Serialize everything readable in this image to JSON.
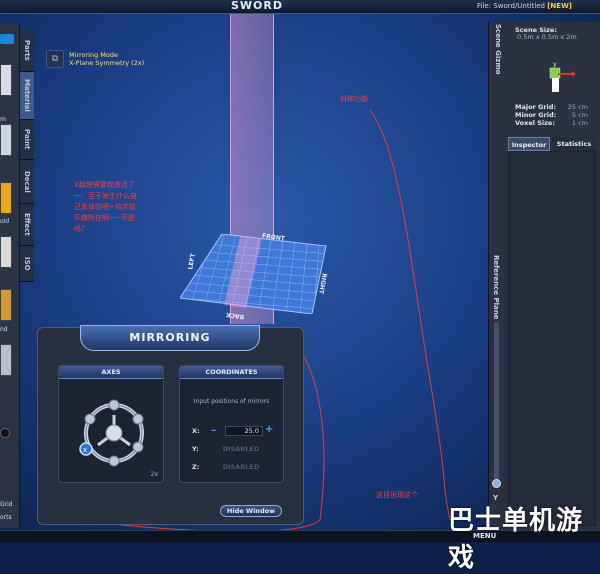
{
  "app": {
    "title": "SWORD",
    "file_prefix": "File:",
    "file_name": "Sword/Untitled",
    "file_badge": "[NEW]"
  },
  "left_panel": {
    "labels": [
      "m",
      "old",
      "nd",
      "Grid",
      "orts"
    ],
    "swatch_colors": [
      "#d9dce4",
      "#cfd3dc",
      "#e8a81c",
      "#d8d8d8",
      "#d49a3a",
      "#b9bfca"
    ]
  },
  "left_tabs": {
    "items": [
      "Parts",
      "Material",
      "Paint",
      "Decal",
      "Effect",
      "ISO"
    ],
    "active_index": 1
  },
  "mode": {
    "title": "Mirroring Mode",
    "subtitle": "X-Plane Symmetry (2x)"
  },
  "plane": {
    "front": "FRONT",
    "back": "BACK",
    "left": "LEFT",
    "right": "RIGHT"
  },
  "annotations": {
    "top": "对称功能",
    "middle": "X翻理需要我激活了\n一、至于发生什么自\n己去体验吧~坊才前\n乐趣所在啊~~不是\n吗？",
    "bottom": "这目出现这个"
  },
  "right_panel": {
    "scene_gizmo_tab": "Scene Gizmo",
    "scene_size_label": "Scene Size:",
    "scene_size_value": "0.5m x 0.5m x 2m",
    "major_grid_label": "Major Grid:",
    "major_grid_value": "25 cm",
    "minor_grid_label": "Minor Grid:",
    "minor_grid_value": "5 cm",
    "voxel_size_label": "Voxel Size:",
    "voxel_size_value": "1 cm",
    "tabs": [
      "Inspector",
      "Statistics"
    ],
    "active_tab": 0,
    "reference_plane": "Reference Plane",
    "axis_y": "Y"
  },
  "mirroring": {
    "title": "MIRRORING",
    "axes_header": "AXES",
    "axes_scale": "2x",
    "coordinates_header": "COORDINATES",
    "coordinates_hint": "Input positions of mirrors",
    "x_label": "X:",
    "x_value": "25.0",
    "y_label": "Y:",
    "y_value": "DISABLED",
    "z_label": "Z:",
    "z_value": "DISABLED",
    "hide_button": "Hide Window"
  },
  "bottom": {
    "menu": "MENU"
  },
  "watermark": "巴士单机游戏"
}
